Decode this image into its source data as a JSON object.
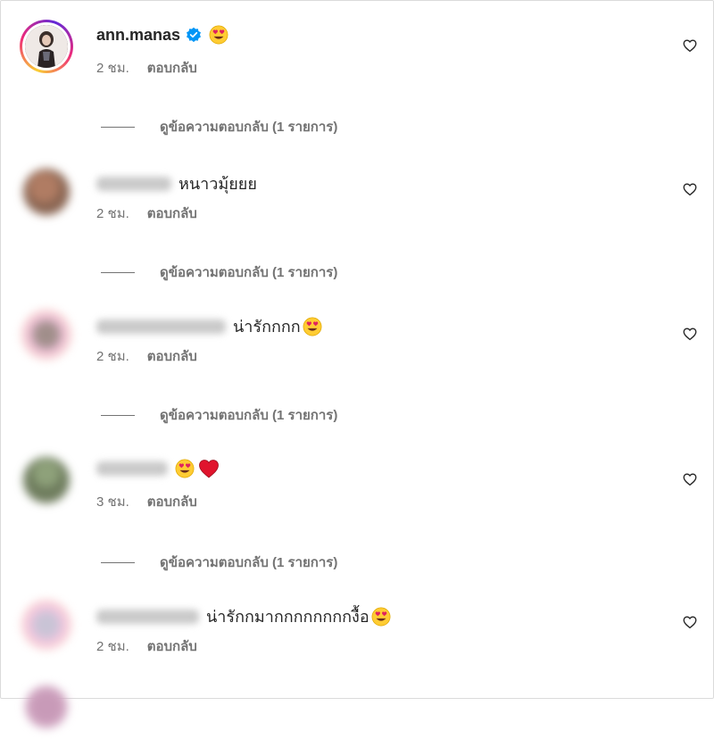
{
  "comments": [
    {
      "username": "ann.manas",
      "verified": true,
      "text": "",
      "emojis": [
        "heart-eyes"
      ],
      "time": "2 ชม.",
      "reply_label": "ตอบกลับ",
      "view_replies": "ดูข้อความตอบกลับ (1 รายการ)"
    },
    {
      "username_blurred": true,
      "text": "หนาวมุ้ยยย",
      "emojis": [],
      "time": "2 ชม.",
      "reply_label": "ตอบกลับ",
      "view_replies": "ดูข้อความตอบกลับ (1 รายการ)"
    },
    {
      "username_blurred": true,
      "text": "น่ารักกกก",
      "emojis": [
        "heart-eyes"
      ],
      "time": "2 ชม.",
      "reply_label": "ตอบกลับ",
      "view_replies": "ดูข้อความตอบกลับ (1 รายการ)"
    },
    {
      "username_blurred": true,
      "text": "",
      "emojis": [
        "heart-eyes",
        "red-heart"
      ],
      "time": "3 ชม.",
      "reply_label": "ตอบกลับ",
      "view_replies": "ดูข้อความตอบกลับ (1 รายการ)"
    },
    {
      "username_blurred": true,
      "text": "น่ารักกมากกกกกกกกงื้อ",
      "emojis": [
        "heart-eyes"
      ],
      "time": "2 ชม.",
      "reply_label": "ตอบกลับ"
    }
  ],
  "icons": {
    "like": "heart-outline-icon",
    "verified": "verified-badge-icon"
  },
  "colors": {
    "verified_blue": "#0095f6",
    "secondary_text": "#737373",
    "heart_red": "#e0245e",
    "emoji_face": "#ffcc33"
  }
}
